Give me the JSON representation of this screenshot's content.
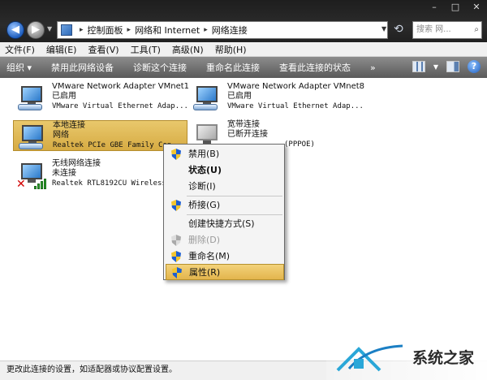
{
  "window": {
    "controls": [
      "–",
      "□",
      "✕"
    ]
  },
  "address": {
    "breadcrumbs": [
      "控制面板",
      "网络和 Internet",
      "网络连接"
    ],
    "search_placeholder": "搜索 网..."
  },
  "menu": [
    "文件(F)",
    "编辑(E)",
    "查看(V)",
    "工具(T)",
    "高级(N)",
    "帮助(H)"
  ],
  "toolbar": {
    "items": [
      "组织 ▾",
      "禁用此网络设备",
      "诊断这个连接",
      "重命名此连接",
      "查看此连接的状态"
    ],
    "more": "»"
  },
  "connections": [
    {
      "name": "VMware Network Adapter VMnet1",
      "status": "已启用",
      "adapter": "VMware Virtual Ethernet Adap..."
    },
    {
      "name": "VMware Network Adapter VMnet8",
      "status": "已启用",
      "adapter": "VMware Virtual Ethernet Adap..."
    },
    {
      "name": "本地连接",
      "status": "网络",
      "adapter": "Realtek PCIe GBE Family Con..."
    },
    {
      "name": "宽带连接",
      "status": "已断开连接",
      "adapter": "(PPPOE)"
    },
    {
      "name": "无线网络连接",
      "status": "未连接",
      "adapter": "Realtek RTL8192CU Wireless ..."
    }
  ],
  "context_menu": {
    "items": [
      "禁用(B)",
      "状态(U)",
      "诊断(I)",
      "桥接(G)",
      "创建快捷方式(S)",
      "删除(D)",
      "重命名(M)",
      "属性(R)"
    ]
  },
  "status_bar": "更改此连接的设置，如适配器或协议配置设置。",
  "watermark": "系统之家",
  "colors": {
    "selection": "#d6ab43",
    "toolbar": "#6b6b6b",
    "titlebar": "#222222"
  }
}
